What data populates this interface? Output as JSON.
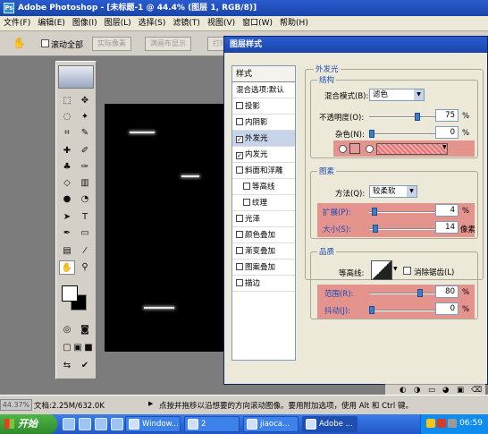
{
  "window": {
    "title": "Adobe Photoshop - [未标题-1 @ 44.4% (图层 1, RGB/8)]"
  },
  "menu": [
    "文件(F)",
    "编辑(E)",
    "图像(I)",
    "图层(L)",
    "选择(S)",
    "滤镜(T)",
    "视图(V)",
    "窗口(W)",
    "帮助(H)"
  ],
  "options": {
    "scroll_all_label": "滚动全部",
    "btn1": "实际像素",
    "btn2": "满画布显示",
    "btn3": "打印"
  },
  "dialog": {
    "title": "图层样式",
    "list_header": "样式",
    "items": [
      {
        "label": "混合选项:默认",
        "check": false,
        "sub": false,
        "sel": false,
        "box": false
      },
      {
        "label": "投影",
        "check": false,
        "sub": false,
        "sel": false,
        "box": true
      },
      {
        "label": "内阴影",
        "check": false,
        "sub": false,
        "sel": false,
        "box": true
      },
      {
        "label": "外发光",
        "check": true,
        "sub": false,
        "sel": true,
        "box": true
      },
      {
        "label": "内发光",
        "check": true,
        "sub": false,
        "sel": false,
        "box": true
      },
      {
        "label": "斜面和浮雕",
        "check": false,
        "sub": false,
        "sel": false,
        "box": true
      },
      {
        "label": "等高线",
        "check": false,
        "sub": true,
        "sel": false,
        "box": true
      },
      {
        "label": "纹理",
        "check": false,
        "sub": true,
        "sel": false,
        "box": true
      },
      {
        "label": "光泽",
        "check": false,
        "sub": false,
        "sel": false,
        "box": true
      },
      {
        "label": "颜色叠加",
        "check": false,
        "sub": false,
        "sel": false,
        "box": true
      },
      {
        "label": "渐变叠加",
        "check": false,
        "sub": false,
        "sel": false,
        "box": true
      },
      {
        "label": "图案叠加",
        "check": false,
        "sub": false,
        "sel": false,
        "box": true
      },
      {
        "label": "描边",
        "check": false,
        "sub": false,
        "sel": false,
        "box": true
      }
    ],
    "outer_glow": "外发光",
    "structure": {
      "title": "结构",
      "blend_label": "混合模式(B):",
      "blend_value": "滤色",
      "opacity_label": "不透明度(O):",
      "opacity_value": "75",
      "opacity_level": 0.75,
      "noise_label": "杂色(N):",
      "noise_value": "0",
      "noise_level": 0.0
    },
    "elements": {
      "title": "图素",
      "method_label": "方法(Q):",
      "method_value": "较柔软",
      "spread_label": "扩展(P):",
      "spread_value": "4",
      "spread_level": 0.04,
      "size_label": "大小(S):",
      "size_value": "14",
      "size_unit": "像素",
      "size_level": 0.06
    },
    "quality": {
      "title": "品质",
      "contour_label": "等高线:",
      "antialias_label": "消除锯齿(L)",
      "range_label": "范围(R):",
      "range_value": "80",
      "range_level": 0.8,
      "jitter_label": "抖动(J):",
      "jitter_value": "0",
      "jitter_level": 0.0
    },
    "percent": "%"
  },
  "status": {
    "zoom": "44.37%",
    "doc": "文档:2.25M/632.0K",
    "tip": "点按并拖移以沿想要的方向滚动图像。要用附加选项，使用 Alt 和 Ctrl 键。"
  },
  "taskbar": {
    "start": "开始",
    "tasks": [
      "Window...",
      "2",
      "jiaoca...",
      "Adobe ..."
    ],
    "time": "06:59"
  }
}
